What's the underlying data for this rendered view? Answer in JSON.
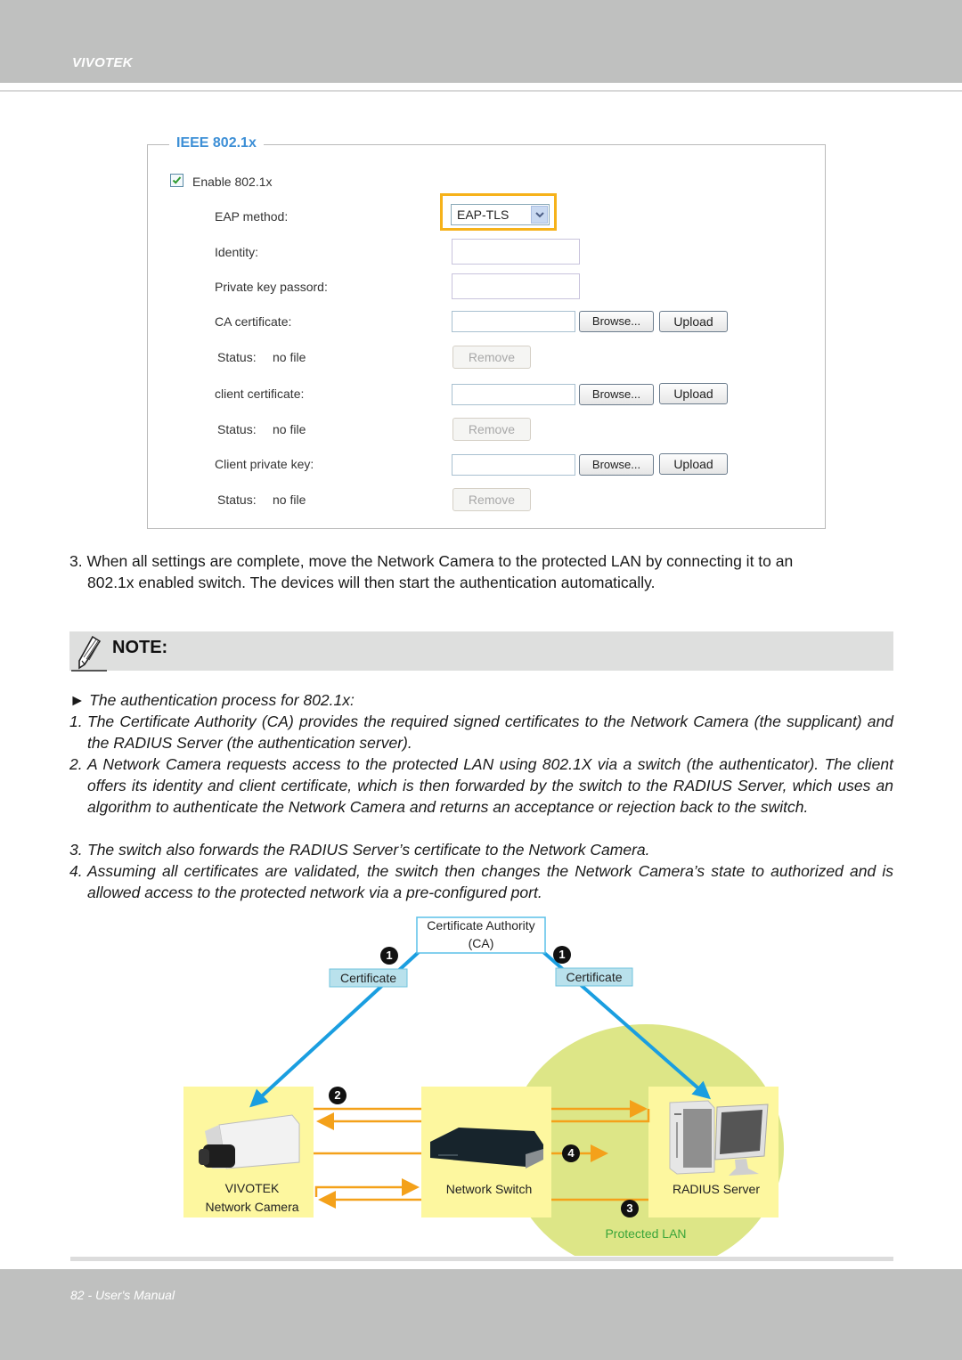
{
  "header": {
    "brand": "VIVOTEK"
  },
  "form": {
    "legend": "IEEE 802.1x",
    "enable_checkbox": {
      "label": "Enable 802.1x",
      "checked": true
    },
    "eap_method": {
      "label": "EAP method:",
      "value": "EAP-TLS"
    },
    "identity": {
      "label": "Identity:",
      "value": ""
    },
    "private_key_password": {
      "label": "Private key passord:",
      "value": ""
    },
    "ca_certificate": {
      "label": "CA certificate:",
      "browse": "Browse...",
      "upload": "Upload",
      "status_label": "Status:",
      "status_value": "no file",
      "remove": "Remove"
    },
    "client_certificate": {
      "label": "client certificate:",
      "browse": "Browse...",
      "upload": "Upload",
      "status_label": "Status:",
      "status_value": "no file",
      "remove": "Remove"
    },
    "client_private_key": {
      "label": "Client private key:",
      "browse": "Browse...",
      "upload": "Upload",
      "status_label": "Status:",
      "status_value": "no file",
      "remove": "Remove"
    }
  },
  "step3": {
    "line1": "3. When all settings are complete, move the Network Camera to the protected LAN by connecting it to an",
    "line2": "802.1x enabled switch. The devices will then start the authentication automatically."
  },
  "note": {
    "label": "NOTE:",
    "intro": "► The authentication process for 802.1x:",
    "items": [
      {
        "num": "1.",
        "text": "The Certificate Authority (CA) provides the required signed certificates to the Network Camera (the supplicant) and the RADIUS Server (the authentication server)."
      },
      {
        "num": "2.",
        "text": "A Network Camera requests access to the protected LAN using 802.1X via a switch (the authenticator). The client offers its identity and client certificate, which is then forwarded by the switch to the RADIUS Server, which uses an algorithm to authenticate the Network Camera and returns an acceptance or rejection back to the switch."
      },
      {
        "num": "3.",
        "text": "The switch also forwards the RADIUS Server’s certificate to the Network Camera."
      },
      {
        "num": "4.",
        "text": "Assuming all certificates are validated, the switch then changes the Network Camera’s state to authorized and is allowed access to the protected network via a pre-configured port."
      }
    ]
  },
  "diagram": {
    "ca_line1": "Certificate Authority",
    "ca_line2": "(CA)",
    "cert_left": "Certificate",
    "cert_right": "Certificate",
    "camera_line1": "VIVOTEK",
    "camera_line2": "Network Camera",
    "switch": "Network Switch",
    "radius": "RADIUS Server",
    "protected_lan": "Protected LAN",
    "step_badges": [
      "1",
      "1",
      "2",
      "3",
      "4"
    ],
    "colors": {
      "arrow_blue": "#1a9ee0",
      "arrow_orange": "#f4a11a",
      "box_yellow": "#fdf79f",
      "lan_green": "#dde687",
      "lan_text": "#3aa53a"
    }
  },
  "footer": {
    "page": "82 - User's Manual"
  }
}
